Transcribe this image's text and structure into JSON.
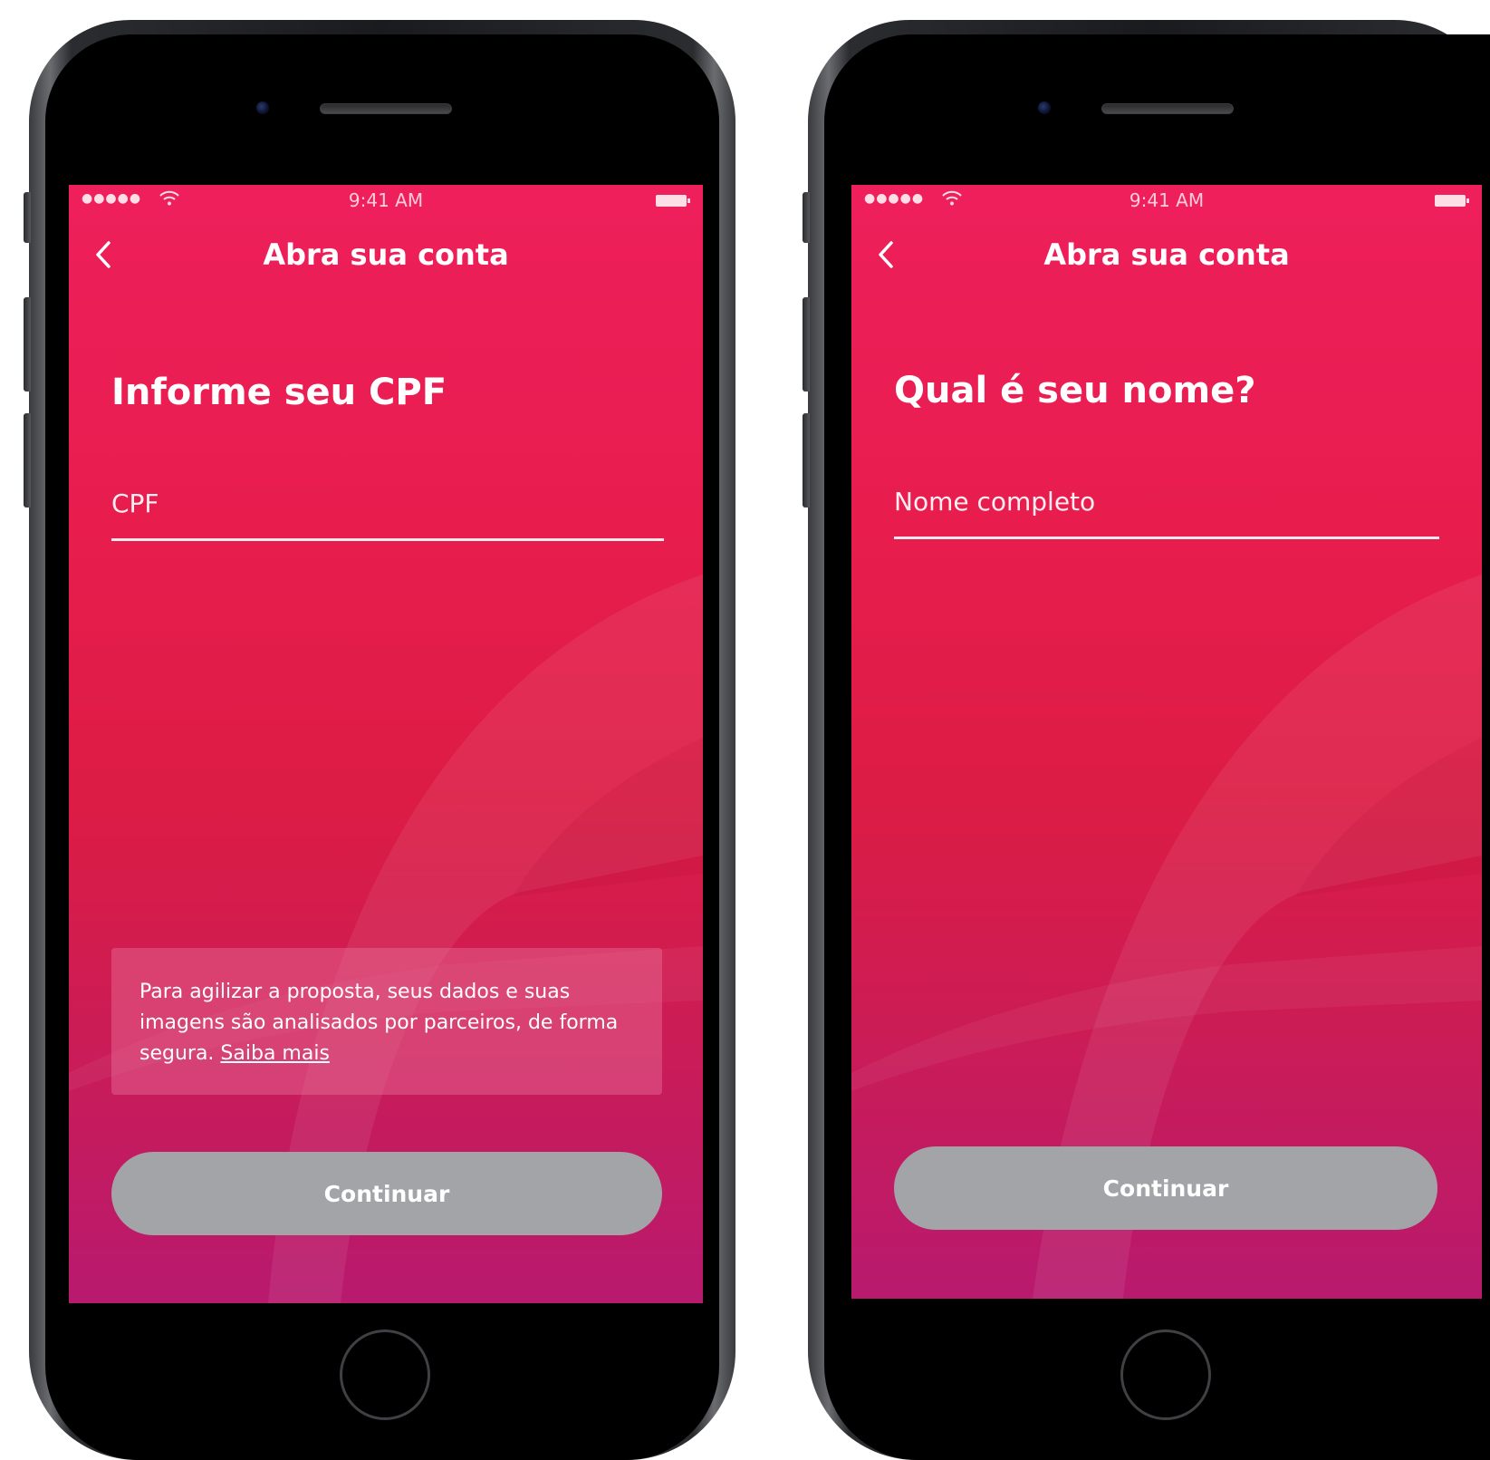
{
  "screens": [
    {
      "status_bar": {
        "signal": "●●●●●",
        "time": "9:41 AM"
      },
      "nav": {
        "back_icon": "chevron-left-icon",
        "title": "Abra sua conta"
      },
      "heading": "Informe seu CPF",
      "input": {
        "placeholder": "CPF",
        "value": ""
      },
      "info": {
        "text": "Para agilizar a proposta, seus dados e suas imagens são analisados por parceiros, de forma segura.",
        "link": "Saiba mais"
      },
      "continue_label": "Continuar"
    },
    {
      "status_bar": {
        "signal": "●●●●●",
        "time": "9:41 AM"
      },
      "nav": {
        "back_icon": "chevron-left-icon",
        "title": "Abra sua conta"
      },
      "heading": "Qual é seu nome?",
      "input": {
        "placeholder": "Nome completo",
        "value": ""
      },
      "continue_label": "Continuar"
    }
  ],
  "colors": {
    "screen_top": "#ee1f5b",
    "screen_bottom": "#b81a6e",
    "button_disabled": "#a3a4a8",
    "text": "#ffffff"
  }
}
